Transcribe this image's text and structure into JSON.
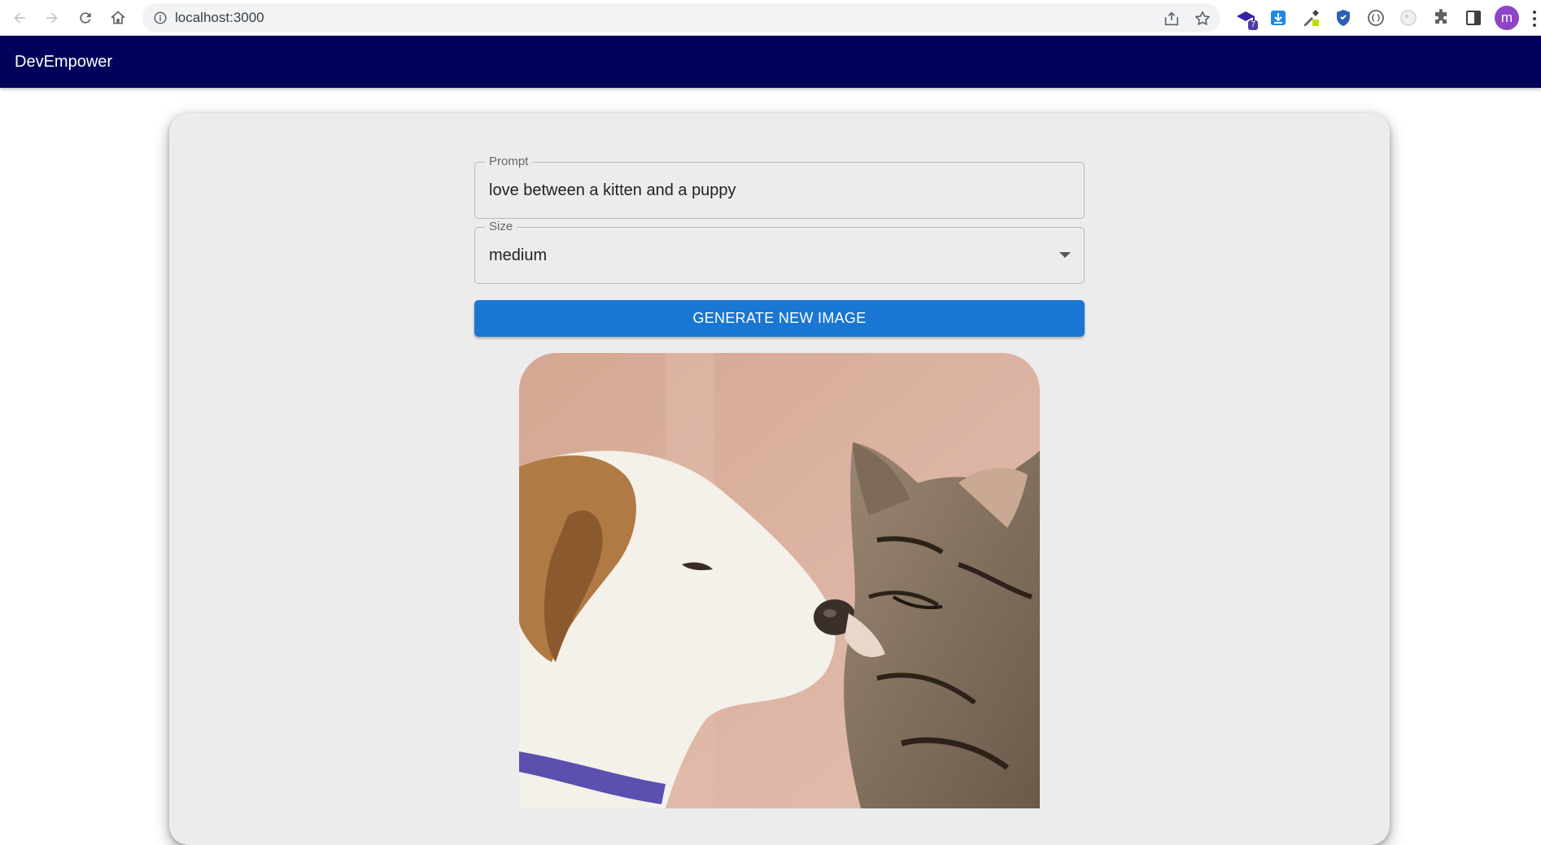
{
  "browser": {
    "url": "localhost:3000",
    "extension_badge": "7",
    "profile_initial": "m"
  },
  "header": {
    "title": "DevEmpower",
    "bg_color": "#02025a"
  },
  "form": {
    "prompt": {
      "label": "Prompt",
      "value": "love between a kitten and a puppy"
    },
    "size": {
      "label": "Size",
      "selected": "medium"
    },
    "generate_label": "GENERATE NEW IMAGE",
    "accent_color": "#1976d2"
  },
  "result": {
    "image_icon": "generated-image-puppy-kitten"
  }
}
